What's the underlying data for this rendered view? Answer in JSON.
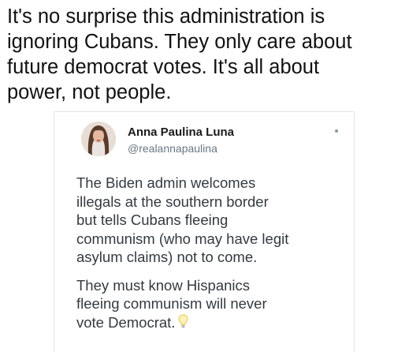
{
  "post": {
    "caption_lines": [
      "It's no surprise this administration is",
      "ignoring Cubans. They only care about",
      "future democrat votes. It's all about",
      "power, not people."
    ]
  },
  "tweet": {
    "author_name": "Anna Paulina Luna",
    "author_handle": "@realannapaulina",
    "paragraph1_lines": [
      "The Biden admin welcomes",
      "illegals at the southern border",
      "but tells Cubans fleeing",
      "communism (who may have legit",
      "asylum claims) not to come."
    ],
    "paragraph2_lines": [
      "They must know Hispanics",
      "fleeing communism will never",
      "vote Democrat."
    ],
    "trailing_emoji": "lightbulb-icon",
    "colors": {
      "text": "#333a40",
      "handle": "#6b7785",
      "border": "#e3e3e3"
    }
  }
}
